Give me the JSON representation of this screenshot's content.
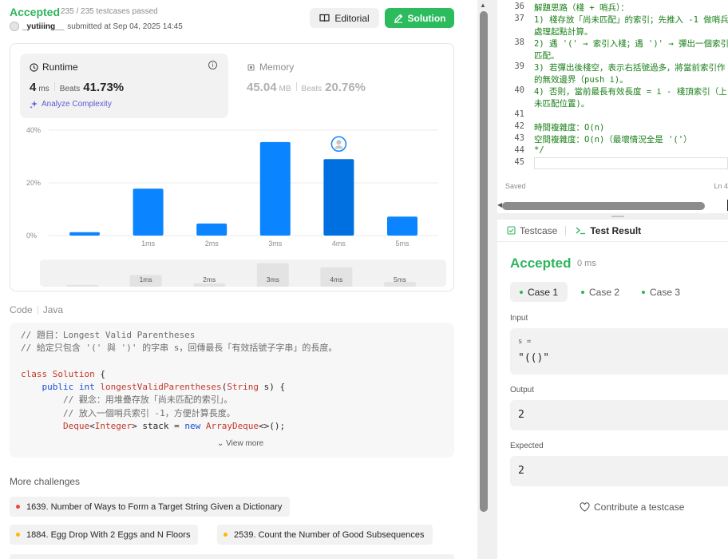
{
  "submission": {
    "status": "Accepted",
    "testcases": "235 / 235 testcases passed",
    "username": "_yutiiing__",
    "submitted_at": "submitted at Sep 04, 2025 14:45",
    "editorial_label": "Editorial",
    "solution_label": "Solution"
  },
  "runtime": {
    "title": "Runtime",
    "value": "4",
    "unit": "ms",
    "beats_label": "Beats",
    "beats": "41.73%",
    "analyze": "Analyze Complexity"
  },
  "memory": {
    "title": "Memory",
    "value": "45.04",
    "unit": "MB",
    "beats_label": "Beats",
    "beats": "20.76%"
  },
  "chart_data": {
    "type": "bar",
    "categories": [
      "0ms",
      "1ms",
      "2ms",
      "3ms",
      "4ms",
      "5ms"
    ],
    "tick_labels": [
      "",
      "1ms",
      "2ms",
      "3ms",
      "4ms",
      "5ms"
    ],
    "values": [
      1.3,
      17.8,
      4.6,
      35.5,
      29.0,
      7.2
    ],
    "highlight": "4ms",
    "ylim": [
      0,
      40
    ],
    "yticks": [
      "0%",
      "20%",
      "40%"
    ],
    "ytick_values": [
      0,
      20,
      40
    ],
    "grid": true,
    "colors": {
      "bar": "#0a84ff",
      "highlight": "#0070e0",
      "grid": "#ebebeb"
    }
  },
  "code_section": {
    "label": "Code",
    "lang": "Java",
    "lines": [
      "// 題目：Longest Valid Parentheses",
      "// 給定只包含 '(' 與 ')' 的字串 s，回傳最長「有效括號子字串」的長度。",
      "",
      "class Solution {",
      "    public int longestValidParentheses(String s) {",
      "        // 觀念：用堆疊存放「尚未匹配的索引」。",
      "        // 放入一個哨兵索引 -1，方便計算長度。",
      "        Deque<Integer> stack = new ArrayDeque<>();"
    ],
    "view_more": "View more"
  },
  "more_challenges": {
    "label": "More challenges",
    "items": [
      {
        "title": "1639. Number of Ways to Form a Target String Given a Dictionary",
        "color": "#ef4743"
      },
      {
        "title": "1884. Egg Drop With 2 Eggs and N Floors",
        "color": "#ffb800"
      },
      {
        "title": "2539. Count the Number of Good Subsequences",
        "color": "#ffb800"
      }
    ]
  },
  "editor": {
    "lines": [
      {
        "n": "36",
        "text": "解題思路（棧 + 哨兵）："
      },
      {
        "n": "37",
        "text": "1) 棧存放「尚未匹配」的索引；先推入 -1 做哨兵"
      },
      {
        "n": "",
        "text": "處理起點計算。"
      },
      {
        "n": "38",
        "text": "2) 遇 '(' → 索引入棧；遇 ')' → 彈出一個索引"
      },
      {
        "n": "",
        "text": "匹配。"
      },
      {
        "n": "39",
        "text": "3) 若彈出後棧空，表示右括號過多，將當前索引作"
      },
      {
        "n": "",
        "text": "的無效邊界（push i)。"
      },
      {
        "n": "40",
        "text": "4) 否則，當前最長有效長度 = i - 棧頂索引（上"
      },
      {
        "n": "",
        "text": "未匹配位置)。"
      },
      {
        "n": "41",
        "text": ""
      },
      {
        "n": "42",
        "text": "時間複雜度：O(n)"
      },
      {
        "n": "43",
        "text": "空間複雜度：O(n)（最壞情況全是 '('）"
      },
      {
        "n": "44",
        "text": "*/"
      },
      {
        "n": "45",
        "text": ""
      }
    ],
    "saved": "Saved",
    "position": "Ln 4"
  },
  "result": {
    "tab_testcase": "Testcase",
    "tab_result": "Test Result",
    "status": "Accepted",
    "time": "0 ms",
    "cases": [
      "Case 1",
      "Case 2",
      "Case 3"
    ],
    "input_label": "Input",
    "input_var": "s =",
    "input_value": "\"(()\"",
    "output_label": "Output",
    "output_value": "2",
    "expected_label": "Expected",
    "expected_value": "2",
    "contribute": "Contribute a testcase"
  }
}
